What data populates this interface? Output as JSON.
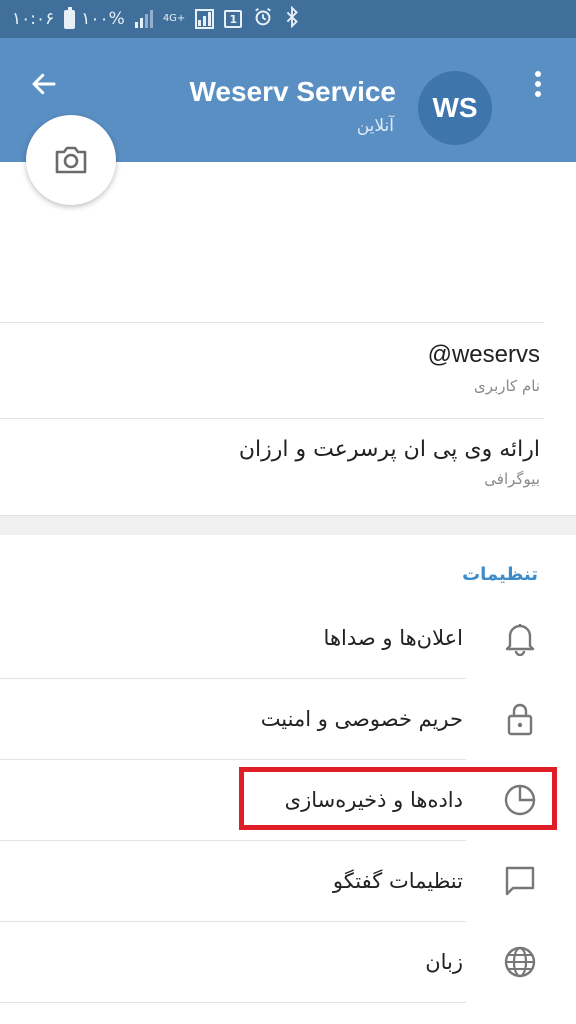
{
  "status_bar": {
    "time": "۱۰:۰۶",
    "battery": "۱۰۰%",
    "network": "4G+",
    "sim": "1",
    "icons": [
      "battery-icon",
      "signal-icon",
      "alarm-icon",
      "bluetooth-icon"
    ]
  },
  "header": {
    "title": "Weserv Service",
    "status": "آنلاین",
    "avatar_initials": "WS",
    "colors": {
      "bar": "#5a8fc3",
      "status_bar": "#3f6f9a",
      "avatar": "#3e75ab"
    }
  },
  "info": {
    "username_value": "@weservs",
    "username_label": "نام کاربری",
    "bio_value": "ارائه وی پی ان پرسرعت و ارزان",
    "bio_label": "بیوگرافی"
  },
  "settings": {
    "title": "تنظیمات",
    "title_color": "#3d8cc9",
    "items": [
      {
        "label": "اعلان‌ها و صداها",
        "icon": "bell-icon"
      },
      {
        "label": "حریم خصوصی و امنیت",
        "icon": "lock-icon"
      },
      {
        "label": "داده‌ها و ذخیره‌سازی",
        "icon": "pie-chart-icon",
        "highlighted": true
      },
      {
        "label": "تنظیمات گفتگو",
        "icon": "chat-bubble-icon"
      },
      {
        "label": "زبان",
        "icon": "globe-icon"
      }
    ],
    "highlight_color": "#e01e27"
  }
}
